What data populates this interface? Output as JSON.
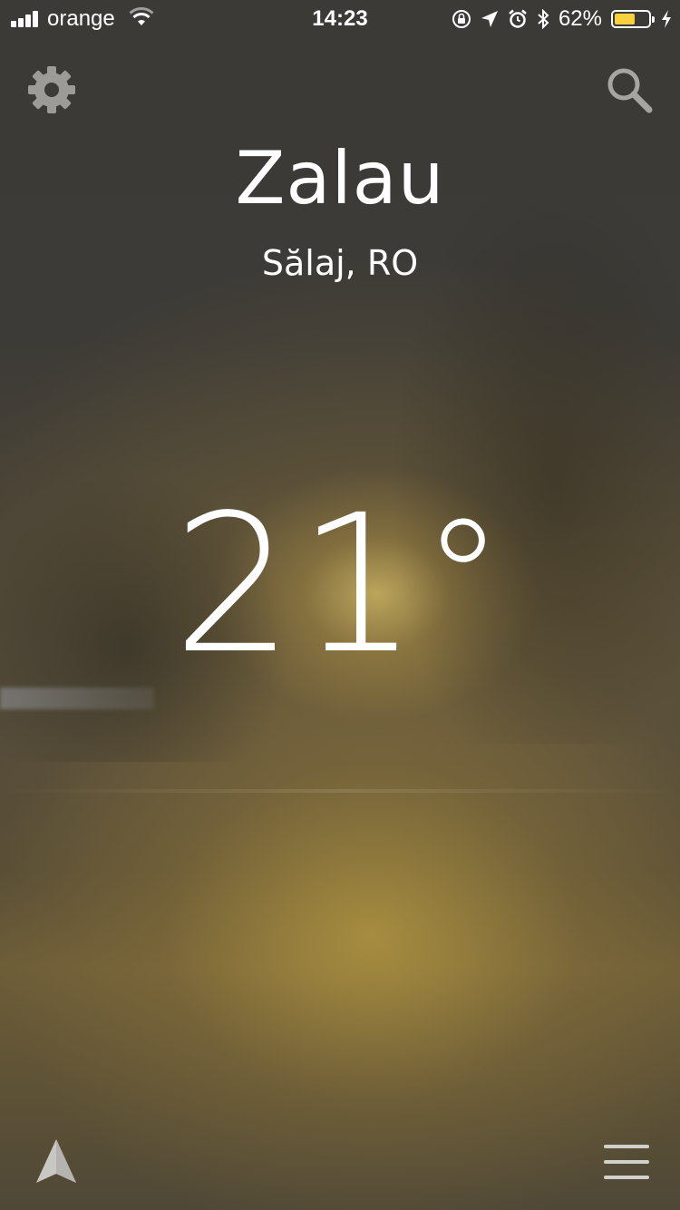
{
  "status_bar": {
    "carrier": "orange",
    "time": "14:23",
    "battery_percent": "62%",
    "battery_level": 0.62,
    "battery_color": "#f7d23e",
    "icons": [
      "signal-icon",
      "wifi-icon",
      "rotation-lock-icon",
      "location-arrow-icon",
      "alarm-icon",
      "bluetooth-icon",
      "battery-icon",
      "charging-icon"
    ]
  },
  "header": {
    "settings_icon": "gear-icon",
    "search_icon": "search-icon"
  },
  "location": {
    "city": "Zalau",
    "region": "Sălaj, RO"
  },
  "weather": {
    "temperature": "21",
    "unit_symbol": "°"
  },
  "footer": {
    "location_icon": "navigation-arrow-icon",
    "menu_icon": "hamburger-menu-icon"
  }
}
